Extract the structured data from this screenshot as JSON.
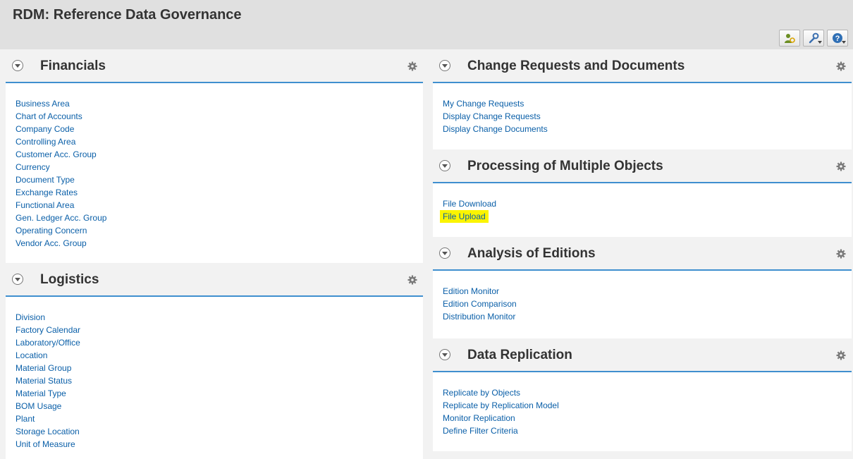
{
  "app": {
    "title": "RDM: Reference Data Governance"
  },
  "toolbar": {
    "buttons": [
      "person-settings-icon",
      "wrench-icon",
      "help-icon"
    ]
  },
  "panels": {
    "financials": {
      "title": "Financials",
      "links": [
        "Business Area",
        "Chart of Accounts",
        "Company Code",
        "Controlling Area",
        "Customer Acc. Group",
        "Currency",
        "Document Type",
        "Exchange Rates",
        "Functional Area",
        "Gen. Ledger Acc. Group",
        "Operating Concern",
        "Vendor Acc. Group"
      ]
    },
    "logistics": {
      "title": "Logistics",
      "links": [
        "Division",
        "Factory Calendar",
        "Laboratory/Office",
        "Location",
        "Material Group",
        "Material Status",
        "Material Type",
        "BOM Usage",
        "Plant",
        "Storage Location",
        "Unit of Measure"
      ]
    },
    "change_requests": {
      "title": "Change Requests and Documents",
      "links": [
        "My Change Requests",
        "Display Change Requests",
        "Display Change Documents"
      ]
    },
    "multiple_objects": {
      "title": "Processing of Multiple Objects",
      "links": [
        "File Download",
        "File Upload"
      ],
      "highlighted": "File Upload"
    },
    "editions": {
      "title": "Analysis of Editions",
      "links": [
        "Edition Monitor",
        "Edition Comparison",
        "Distribution Monitor"
      ]
    },
    "replication": {
      "title": "Data Replication",
      "links": [
        "Replicate by Objects",
        "Replicate by Replication Model",
        "Monitor Replication",
        "Define Filter Criteria"
      ]
    }
  },
  "colors": {
    "accent": "#3f8fcf",
    "link": "#0a5fa8",
    "highlight": "#fbf400"
  }
}
